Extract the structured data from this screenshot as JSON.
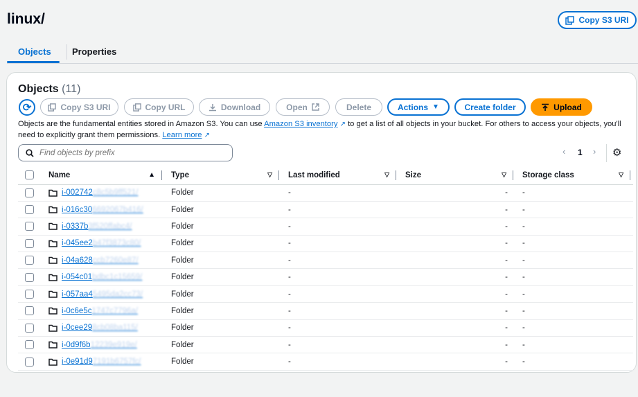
{
  "header": {
    "title": "linux/",
    "copy_uri_label": "Copy S3 URI"
  },
  "tabs": [
    {
      "label": "Objects",
      "active": true
    },
    {
      "label": "Properties",
      "active": false
    }
  ],
  "objects_panel": {
    "title": "Objects",
    "count": "(11)",
    "buttons": {
      "copy_s3_uri": "Copy S3 URI",
      "copy_url": "Copy URL",
      "download": "Download",
      "open": "Open",
      "delete": "Delete",
      "actions": "Actions",
      "create_folder": "Create folder",
      "upload": "Upload"
    },
    "description": {
      "part1": "Objects are the fundamental entities stored in Amazon S3. You can use ",
      "link1": "Amazon S3 inventory",
      "part2": " to get a list of all objects in your bucket. For others to access your objects, you'll need to explicitly grant them permissions. ",
      "link2": "Learn more"
    },
    "search_placeholder": "Find objects by prefix",
    "pagination": {
      "current_page": "1"
    },
    "columns": [
      "Name",
      "Type",
      "Last modified",
      "Size",
      "Storage class"
    ],
    "rows": [
      {
        "name_visible": "i-002742",
        "name_hidden": "c8c5b9ff521/",
        "type": "Folder",
        "last_modified": "-",
        "size": "-",
        "storage_class": "-"
      },
      {
        "name_visible": "i-016c30",
        "name_hidden": "6692067b416/",
        "type": "Folder",
        "last_modified": "-",
        "size": "-",
        "storage_class": "-"
      },
      {
        "name_visible": "i-0337b",
        "name_hidden": "3f520ffabc4/",
        "type": "Folder",
        "last_modified": "-",
        "size": "-",
        "storage_class": "-"
      },
      {
        "name_visible": "i-045ee2",
        "name_hidden": "b47f3873c80/",
        "type": "Folder",
        "last_modified": "-",
        "size": "-",
        "storage_class": "-"
      },
      {
        "name_visible": "i-04a628",
        "name_hidden": "ccb7260e87/",
        "type": "Folder",
        "last_modified": "-",
        "size": "-",
        "storage_class": "-"
      },
      {
        "name_visible": "i-054c01",
        "name_hidden": "bdbc1c15659/",
        "type": "Folder",
        "last_modified": "-",
        "size": "-",
        "storage_class": "-"
      },
      {
        "name_visible": "i-057aa4",
        "name_hidden": "5495da2cc73/",
        "type": "Folder",
        "last_modified": "-",
        "size": "-",
        "storage_class": "-"
      },
      {
        "name_visible": "i-0c6e5c",
        "name_hidden": "1747c7796a/",
        "type": "Folder",
        "last_modified": "-",
        "size": "-",
        "storage_class": "-"
      },
      {
        "name_visible": "i-0cee29",
        "name_hidden": "8cb08ba115/",
        "type": "Folder",
        "last_modified": "-",
        "size": "-",
        "storage_class": "-"
      },
      {
        "name_visible": "i-0d9f6b",
        "name_hidden": "12239e919e/",
        "type": "Folder",
        "last_modified": "-",
        "size": "-",
        "storage_class": "-"
      },
      {
        "name_visible": "i-0e91d9",
        "name_hidden": "7191b6757fc/",
        "type": "Folder",
        "last_modified": "-",
        "size": "-",
        "storage_class": "-"
      }
    ]
  },
  "colors": {
    "link": "#0972d3",
    "upload": "#ff9900"
  }
}
